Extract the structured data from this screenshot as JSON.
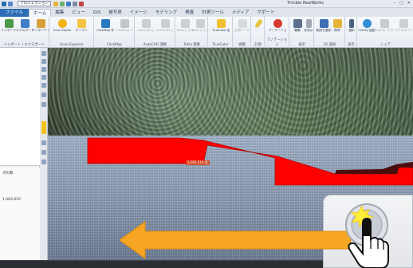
{
  "window": {
    "project_combo": "プロジェクション",
    "app_title": "Trimble RealWorks",
    "controls": [
      "–",
      "□",
      "✕"
    ]
  },
  "tabs": [
    "ファイル",
    "ホーム",
    "編集",
    "ビュー",
    "GIS",
    "被写見",
    "イメージ",
    "モデリング",
    "検査",
    "計測ツール",
    "メディア",
    "サポート"
  ],
  "active_tab_index": 1,
  "ribbon": {
    "groups": [
      {
        "label": "インポート / エクスポート",
        "buttons": [
          "インポート",
          "エクスポート",
          "インポート / 移動"
        ]
      },
      {
        "label": "Scan Explorer",
        "buttons": [
          "Scan Explorer 起動",
          "オーブン"
        ]
      },
      {
        "label": "ClickMap",
        "buttons": [
          "ClickMap 作成",
          "ClickMap ハウス"
        ]
      },
      {
        "label": "AutoCAD 連携",
        "buttons": [
          "AutoCAD にスキャン",
          "AutoCAD にセット"
        ]
      },
      {
        "label": "Tekla 連携",
        "buttons": [
          "Tekla にスキャン",
          "Tekla にセット"
        ]
      },
      {
        "label": "TrueColor",
        "buttons": [
          "TrueColor 起動"
        ]
      },
      {
        "label": "面積",
        "buttons": [
          "計測ツール"
        ]
      },
      {
        "label": "計測",
        "buttons": [
          ""
        ]
      },
      {
        "label": "アノテーション",
        "buttons": [
          "アノテーション"
        ]
      },
      {
        "label": "表示",
        "buttons": [
          "編集",
          "非表示"
        ]
      },
      {
        "label": "3D 選択",
        "buttons": [
          "範囲を選択",
          "削除"
        ]
      },
      {
        "label": "表示",
        "buttons": [
          "選択"
        ]
      },
      {
        "label": "シェア",
        "buttons": [
          "Clarity 起動",
          "Clarity でプロジェクト",
          "エクスポート"
        ]
      }
    ]
  },
  "left_panel": {
    "label_a": "点の数",
    "label_b": "1,083,010"
  },
  "viewport": {
    "point_label": "1,083,010 点"
  },
  "colors": {
    "accent": "#2d6db5",
    "selection": "#ff0000",
    "arrow": "#f6a623",
    "highlight": "#ffe600"
  },
  "icons": {
    "arrow": "left-arrow-icon",
    "hand": "pointing-hand-icon",
    "button": "round-push-button-icon"
  }
}
